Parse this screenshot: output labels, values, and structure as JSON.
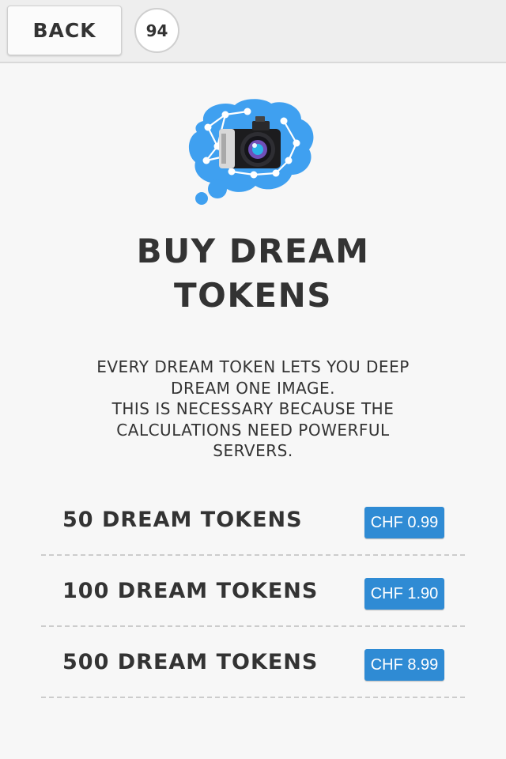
{
  "header": {
    "back_label": "BACK",
    "token_count": "94"
  },
  "logo": {
    "icon": "dream-brain-camera-icon",
    "brain_color": "#3fa0f0"
  },
  "main": {
    "title_line1": "BUY DREAM",
    "title_line2": "TOKENS",
    "description_lines": [
      "EVERY DREAM TOKEN LETS YOU DEEP",
      "DREAM ONE IMAGE.",
      "THIS IS NECESSARY BECAUSE THE",
      "CALCULATIONS NEED POWERFUL",
      "SERVERS."
    ]
  },
  "products": [
    {
      "label": "50 DREAM TOKENS",
      "price": "CHF 0.99"
    },
    {
      "label": "100 DREAM TOKENS",
      "price": "CHF 1.90"
    },
    {
      "label": "500 DREAM TOKENS",
      "price": "CHF 8.99"
    }
  ],
  "colors": {
    "price_button": "#2f8bd4",
    "background": "#f7f7f7"
  }
}
